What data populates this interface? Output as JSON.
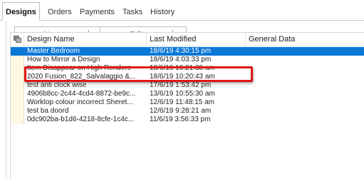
{
  "tabs": [
    {
      "label": "Designs",
      "active": true
    },
    {
      "label": "Orders",
      "active": false
    },
    {
      "label": "Payments",
      "active": false
    },
    {
      "label": "Tasks",
      "active": false
    },
    {
      "label": "History",
      "active": false
    }
  ],
  "toolbar": {
    "new_label": "New",
    "edit_label": "Edit"
  },
  "grid": {
    "columns": [
      "Design Name",
      "Last Modified",
      "General Data"
    ],
    "icon": "grid-options-icon",
    "selected_index": 0,
    "rows": [
      {
        "name": "Master Bedroom",
        "modified": "18/6/19  4:30:15 pm",
        "general": ""
      },
      {
        "name": "How to Mirror a Design",
        "modified": "18/6/19  4:03:33 pm",
        "general": ""
      },
      {
        "name": "Item Disappear on High Renders",
        "modified": "18/6/19  10:21:38 am",
        "general": ""
      },
      {
        "name": "2020 Fusion_822_Salvalaggio &...",
        "modified": "18/6/19  10:20:43 am",
        "general": ""
      },
      {
        "name": "test anti clock wise",
        "modified": "17/6/19  1:53:42 pm",
        "general": ""
      },
      {
        "name": "4906b8cc-2c44-4cd4-8872-be9c...",
        "modified": "13/6/19  10:55:30 am",
        "general": ""
      },
      {
        "name": "Worktop colour incorrect Sheret...",
        "modified": "12/6/19  11:48:15 am",
        "general": ""
      },
      {
        "name": "test ba doord",
        "modified": "12/6/19  9:28:21 am",
        "general": ""
      },
      {
        "name": "0dc902ba-b1d6-4218-8cfe-1c4c...",
        "modified": "11/6/19  3:56:33 pm",
        "general": ""
      }
    ]
  },
  "colors": {
    "selection": "#0a78d7",
    "highlight_border": "#e01515",
    "indicator_cell": "#fcf8e3"
  }
}
